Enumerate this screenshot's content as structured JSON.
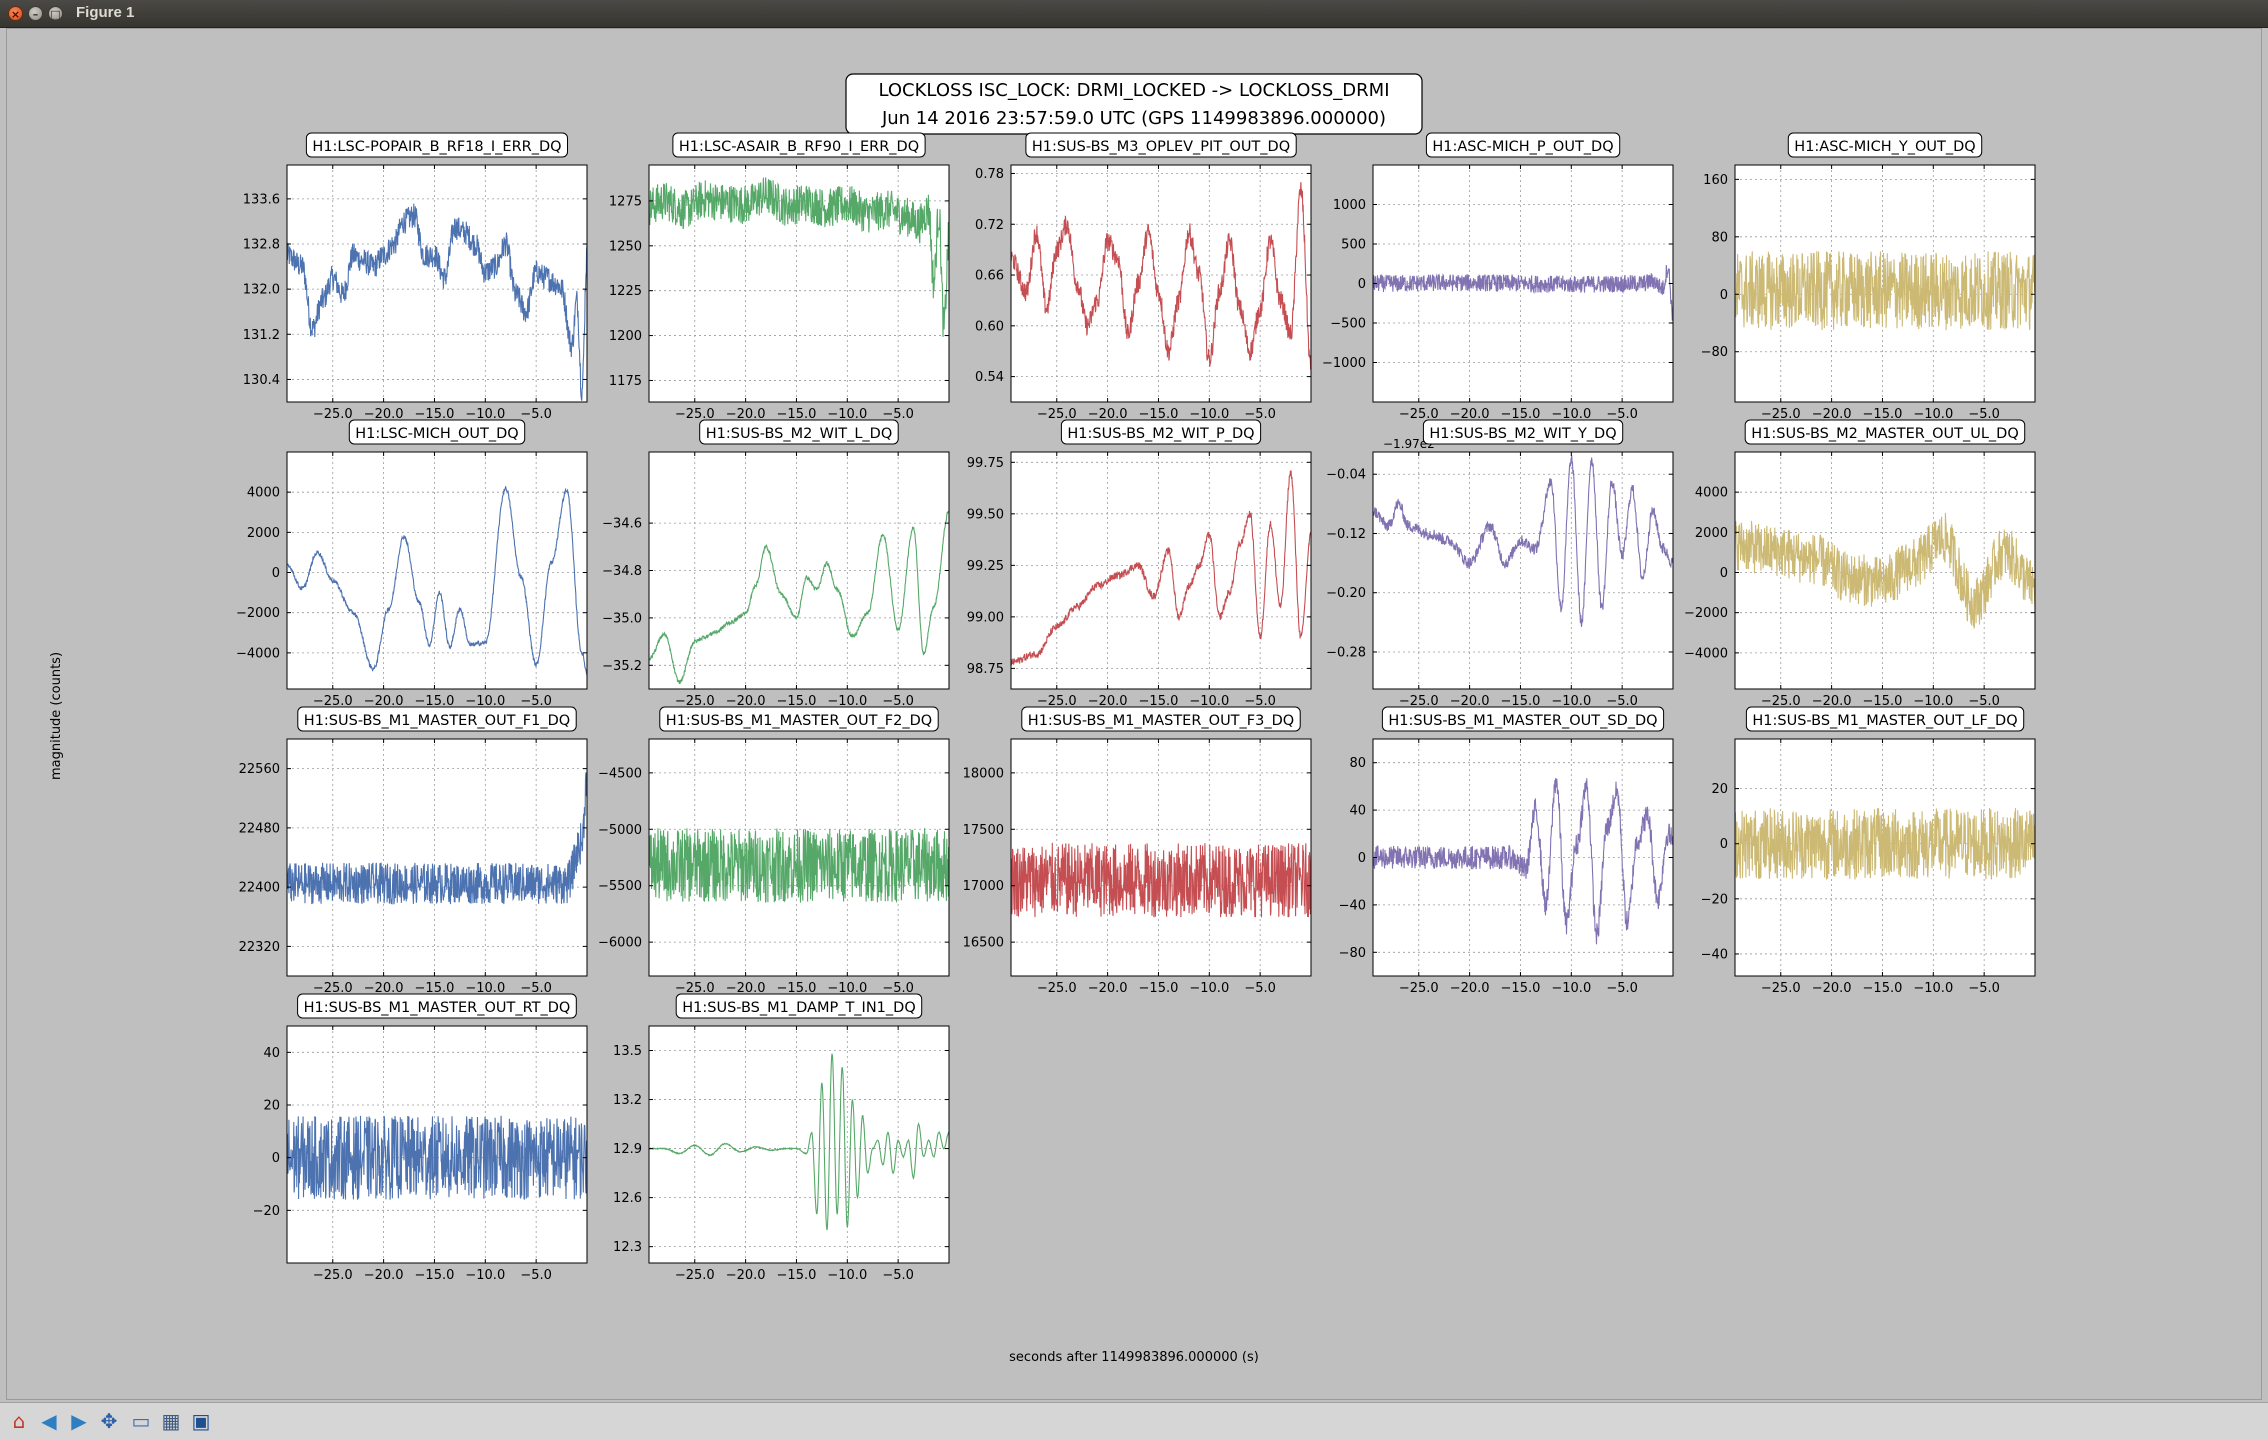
{
  "window": {
    "title": "Figure 1",
    "close_glyph": "×",
    "min_glyph": "–",
    "max_glyph": "□"
  },
  "figure": {
    "title_line1": "LOCKLOSS ISC_LOCK: DRMI_LOCKED -> LOCKLOSS_DRMI",
    "title_line2": "Jun 14 2016 23:57:59.0 UTC (GPS 1149983896.000000)",
    "ylabel": "magnitude (counts)",
    "xlabel": "seconds after 1149983896.000000 (s)"
  },
  "toolbar": [
    {
      "name": "home-icon",
      "glyph": "⌂",
      "color": "#c0392b"
    },
    {
      "name": "back-arrow-icon",
      "glyph": "◀",
      "color": "#2e7fc1"
    },
    {
      "name": "forward-arrow-icon",
      "glyph": "▶",
      "color": "#2e7fc1"
    },
    {
      "name": "pan-icon",
      "glyph": "✥",
      "color": "#2b5fa8"
    },
    {
      "name": "zoom-icon",
      "glyph": "▭",
      "color": "#3b6fb3"
    },
    {
      "name": "subplots-configure-icon",
      "glyph": "▦",
      "color": "#3d5a80"
    },
    {
      "name": "save-icon",
      "glyph": "▣",
      "color": "#1d4f91"
    }
  ],
  "chart_data": [
    {
      "type": "line",
      "title": "H1:LSC-POPAIR_B_RF18_I_ERR_DQ",
      "color": "#4c72b0",
      "xlim": [
        -29.5,
        0
      ],
      "xticks": [
        -25.0,
        -20.0,
        -15.0,
        -10.0,
        -5.0
      ],
      "ylim": [
        130.0,
        134.2
      ],
      "yticks": [
        130.4,
        131.2,
        132.0,
        132.8,
        133.6
      ],
      "ytick_labels": [
        "130.4",
        "131.2",
        "132.0",
        "132.8",
        "133.6"
      ],
      "grid": true,
      "noise": 0.22,
      "x": [
        -29.5,
        -28,
        -27,
        -26,
        -25,
        -24,
        -23,
        -22,
        -21,
        -20,
        -19,
        -18,
        -17,
        -16,
        -15,
        -14,
        -13,
        -12,
        -11,
        -10,
        -9,
        -8,
        -7,
        -6,
        -5,
        -4,
        -3,
        -2.5,
        -1.5,
        -1,
        -0.5,
        0
      ],
      "y": [
        132.6,
        132.4,
        131.3,
        131.8,
        132.2,
        131.9,
        132.6,
        132.5,
        132.4,
        132.6,
        132.8,
        133.2,
        133.3,
        132.6,
        132.6,
        132.2,
        133.1,
        133.0,
        132.8,
        132.3,
        132.4,
        132.8,
        131.9,
        131.6,
        132.3,
        132.2,
        132.1,
        132.0,
        131.0,
        131.8,
        130.2,
        132.6
      ]
    },
    {
      "type": "line",
      "title": "H1:LSC-ASAIR_B_RF90_I_ERR_DQ",
      "color": "#55a868",
      "xlim": [
        -29.5,
        0
      ],
      "xticks": [
        -25.0,
        -20.0,
        -15.0,
        -10.0,
        -5.0
      ],
      "ylim": [
        1163,
        1295
      ],
      "yticks": [
        1175,
        1200,
        1225,
        1250,
        1275
      ],
      "ytick_labels": [
        "1175",
        "1200",
        "1225",
        "1250",
        "1275"
      ],
      "grid": true,
      "noise": 11,
      "x": [
        -29.5,
        -28,
        -26,
        -24,
        -22,
        -20,
        -18,
        -16,
        -14,
        -12,
        -10,
        -8,
        -6,
        -4,
        -3,
        -2,
        -1.5,
        -1,
        -0.5,
        0
      ],
      "y": [
        1272,
        1275,
        1270,
        1276,
        1274,
        1273,
        1278,
        1272,
        1274,
        1271,
        1273,
        1268,
        1270,
        1266,
        1262,
        1270,
        1230,
        1268,
        1205,
        1255
      ]
    },
    {
      "type": "line",
      "title": "H1:SUS-BS_M3_OPLEV_PIT_OUT_DQ",
      "color": "#c44e52",
      "xlim": [
        -29.5,
        0
      ],
      "xticks": [
        -25.0,
        -20.0,
        -15.0,
        -10.0,
        -5.0
      ],
      "ylim": [
        0.51,
        0.79
      ],
      "yticks": [
        0.54,
        0.6,
        0.66,
        0.72,
        0.78
      ],
      "ytick_labels": [
        "0.54",
        "0.60",
        "0.66",
        "0.72",
        "0.78"
      ],
      "grid": true,
      "noise": 0.012,
      "x": [
        -29.5,
        -28,
        -27,
        -26,
        -25,
        -24,
        -23,
        -22,
        -21,
        -20,
        -19,
        -18,
        -17,
        -16,
        -15,
        -14,
        -13,
        -12,
        -11,
        -10,
        -9,
        -8,
        -7,
        -6,
        -5,
        -4,
        -3,
        -2,
        -1,
        0
      ],
      "y": [
        0.68,
        0.64,
        0.71,
        0.62,
        0.69,
        0.72,
        0.65,
        0.6,
        0.63,
        0.7,
        0.68,
        0.59,
        0.65,
        0.71,
        0.64,
        0.57,
        0.63,
        0.71,
        0.66,
        0.56,
        0.64,
        0.7,
        0.62,
        0.57,
        0.62,
        0.7,
        0.63,
        0.59,
        0.76,
        0.55
      ]
    },
    {
      "type": "line",
      "title": "H1:ASC-MICH_P_OUT_DQ",
      "color": "#8172b2",
      "xlim": [
        -29.5,
        0
      ],
      "xticks": [
        -25.0,
        -20.0,
        -15.0,
        -10.0,
        -5.0
      ],
      "ylim": [
        -1500,
        1500
      ],
      "yticks": [
        -1000,
        -500,
        0,
        500,
        1000
      ],
      "ytick_labels": [
        "−1000",
        "−500",
        "0",
        "500",
        "1000"
      ],
      "grid": true,
      "noise": 110,
      "x": [
        -29.5,
        -20,
        -10,
        -3,
        -2,
        -1,
        -0.5,
        0
      ],
      "y": [
        0,
        10,
        -10,
        0,
        30,
        -60,
        200,
        -400
      ]
    },
    {
      "type": "line",
      "title": "H1:ASC-MICH_Y_OUT_DQ",
      "color": "#ccb974",
      "xlim": [
        -29.5,
        0
      ],
      "xticks": [
        -25.0,
        -20.0,
        -15.0,
        -10.0,
        -5.0
      ],
      "ylim": [
        -150,
        180
      ],
      "yticks": [
        -80,
        0,
        80,
        160
      ],
      "ytick_labels": [
        "−80",
        "0",
        "80",
        "160"
      ],
      "grid": true,
      "noise": 55,
      "x": [
        -29.5,
        0
      ],
      "y": [
        5,
        5
      ]
    },
    {
      "type": "line",
      "title": "H1:LSC-MICH_OUT_DQ",
      "color": "#4c72b0",
      "xlim": [
        -29.5,
        0
      ],
      "xticks": [
        -25.0,
        -20.0,
        -15.0,
        -10.0,
        -5.0
      ],
      "ylim": [
        -5800,
        6000
      ],
      "yticks": [
        -4000,
        -2000,
        0,
        2000,
        4000
      ],
      "ytick_labels": [
        "−4000",
        "−2000",
        "0",
        "2000",
        "4000"
      ],
      "grid": true,
      "noise": 110,
      "x": [
        -29.5,
        -28,
        -26.5,
        -25,
        -23,
        -21,
        -19.5,
        -18,
        -16.5,
        -15.5,
        -14.5,
        -13.5,
        -12.5,
        -11.5,
        -10,
        -8,
        -6.5,
        -5,
        -3.5,
        -2,
        -0.5,
        0
      ],
      "y": [
        400,
        -800,
        1000,
        -400,
        -2000,
        -4800,
        -1800,
        1800,
        -1500,
        -3600,
        -1000,
        -3700,
        -1800,
        -3600,
        -3500,
        4200,
        -200,
        -4600,
        500,
        4100,
        -4000,
        -5000
      ]
    },
    {
      "type": "line",
      "title": "H1:SUS-BS_M2_WIT_L_DQ",
      "color": "#55a868",
      "xlim": [
        -29.5,
        0
      ],
      "xticks": [
        -25.0,
        -20.0,
        -15.0,
        -10.0,
        -5.0
      ],
      "ylim": [
        -35.3,
        -34.3
      ],
      "yticks": [
        -35.2,
        -35.0,
        -34.8,
        -34.6
      ],
      "ytick_labels": [
        "−35.2",
        "−35.0",
        "−34.8",
        "−34.6"
      ],
      "grid": true,
      "noise": 0.008,
      "x": [
        -29.5,
        -28,
        -26.5,
        -25,
        -24,
        -23,
        -21.5,
        -20,
        -19,
        -18,
        -16.5,
        -15,
        -14,
        -13,
        -12,
        -11,
        -9.5,
        -8,
        -6.5,
        -5,
        -3.5,
        -2.5,
        -1.5,
        0
      ],
      "y": [
        -35.17,
        -35.07,
        -35.27,
        -35.1,
        -35.08,
        -35.06,
        -35.02,
        -34.98,
        -34.86,
        -34.7,
        -34.9,
        -35.0,
        -34.83,
        -34.88,
        -34.77,
        -34.88,
        -35.08,
        -34.98,
        -34.65,
        -35.05,
        -34.62,
        -35.15,
        -34.95,
        -34.55
      ]
    },
    {
      "type": "line",
      "title": "H1:SUS-BS_M2_WIT_P_DQ",
      "color": "#c44e52",
      "xlim": [
        -29.5,
        0
      ],
      "xticks": [
        -25.0,
        -20.0,
        -15.0,
        -10.0,
        -5.0
      ],
      "ylim": [
        98.65,
        99.8
      ],
      "yticks": [
        98.75,
        99.0,
        99.25,
        99.5,
        99.75
      ],
      "ytick_labels": [
        "98.75",
        "99.00",
        "99.25",
        "99.50",
        "99.75"
      ],
      "grid": true,
      "noise": 0.018,
      "x": [
        -29.5,
        -27,
        -25,
        -23,
        -21,
        -19,
        -17,
        -15.5,
        -14,
        -13,
        -12,
        -11,
        -10,
        -9,
        -8,
        -7,
        -6,
        -5,
        -4,
        -3,
        -2,
        -1,
        0
      ],
      "y": [
        98.78,
        98.82,
        98.95,
        99.05,
        99.15,
        99.2,
        99.25,
        99.1,
        99.32,
        99.0,
        99.15,
        99.25,
        99.4,
        99.0,
        99.12,
        99.35,
        99.5,
        98.9,
        99.45,
        99.05,
        99.7,
        98.9,
        99.4
      ]
    },
    {
      "type": "line",
      "title": "H1:SUS-BS_M2_WIT_Y_DQ",
      "color": "#8172b2",
      "xlim": [
        -29.5,
        0
      ],
      "xticks": [
        -25.0,
        -20.0,
        -15.0,
        -10.0,
        -5.0
      ],
      "ylim": [
        -0.33,
        -0.01
      ],
      "yticks": [
        -0.28,
        -0.2,
        -0.12,
        -0.04
      ],
      "ytick_labels": [
        "−0.28",
        "−0.20",
        "−0.12",
        "−0.04"
      ],
      "offset_text": "−1.97e2",
      "grid": true,
      "noise": 0.008,
      "x": [
        -29.5,
        -28,
        -27,
        -26,
        -24,
        -22,
        -20,
        -18,
        -16.5,
        -15,
        -13.5,
        -12,
        -11,
        -10,
        -9,
        -8,
        -7,
        -6,
        -5,
        -4,
        -3,
        -2,
        -1,
        0
      ],
      "y": [
        -0.09,
        -0.11,
        -0.08,
        -0.11,
        -0.12,
        -0.13,
        -0.16,
        -0.11,
        -0.16,
        -0.13,
        -0.14,
        -0.05,
        -0.22,
        -0.02,
        -0.24,
        -0.02,
        -0.22,
        -0.05,
        -0.15,
        -0.06,
        -0.18,
        -0.09,
        -0.14,
        -0.16
      ]
    },
    {
      "type": "line",
      "title": "H1:SUS-BS_M2_MASTER_OUT_UL_DQ",
      "color": "#ccb974",
      "xlim": [
        -29.5,
        0
      ],
      "xticks": [
        -25.0,
        -20.0,
        -15.0,
        -10.0,
        -5.0
      ],
      "ylim": [
        -5800,
        6000
      ],
      "yticks": [
        -4000,
        -2000,
        0,
        2000,
        4000
      ],
      "ytick_labels": [
        "−4000",
        "−2000",
        "0",
        "2000",
        "4000"
      ],
      "grid": true,
      "noise": 1300,
      "x": [
        -29.5,
        -26,
        -22,
        -18,
        -15,
        -12,
        -9,
        -6,
        -3,
        0
      ],
      "y": [
        1400,
        1100,
        700,
        -300,
        -500,
        400,
        1700,
        -1500,
        1000,
        -700
      ]
    },
    {
      "type": "line",
      "title": "H1:SUS-BS_M1_MASTER_OUT_F1_DQ",
      "color": "#4c72b0",
      "xlim": [
        -29.5,
        0
      ],
      "xticks": [
        -25.0,
        -20.0,
        -15.0,
        -10.0,
        -5.0
      ],
      "ylim": [
        22280,
        22600
      ],
      "yticks": [
        22320,
        22400,
        22480,
        22560
      ],
      "ytick_labels": [
        "22320",
        "22400",
        "22480",
        "22560"
      ],
      "grid": true,
      "noise": 28,
      "x": [
        -29.5,
        -2,
        -0.5,
        0
      ],
      "y": [
        22405,
        22405,
        22460,
        22550
      ]
    },
    {
      "type": "line",
      "title": "H1:SUS-BS_M1_MASTER_OUT_F2_DQ",
      "color": "#55a868",
      "xlim": [
        -29.5,
        0
      ],
      "xticks": [
        -25.0,
        -20.0,
        -15.0,
        -10.0,
        -5.0
      ],
      "ylim": [
        -6300,
        -4200
      ],
      "yticks": [
        -6000,
        -5500,
        -5000,
        -4500
      ],
      "ytick_labels": [
        "−6000",
        "−5500",
        "−5000",
        "−4500"
      ],
      "grid": true,
      "noise": 330,
      "x": [
        -29.5,
        0
      ],
      "y": [
        -5320,
        -5320
      ]
    },
    {
      "type": "line",
      "title": "H1:SUS-BS_M1_MASTER_OUT_F3_DQ",
      "color": "#c44e52",
      "xlim": [
        -29.5,
        0
      ],
      "xticks": [
        -25.0,
        -20.0,
        -15.0,
        -10.0,
        -5.0
      ],
      "ylim": [
        16200,
        18300
      ],
      "yticks": [
        16500,
        17000,
        17500,
        18000
      ],
      "ytick_labels": [
        "16500",
        "17000",
        "17500",
        "18000"
      ],
      "grid": true,
      "noise": 330,
      "x": [
        -29.5,
        0
      ],
      "y": [
        17050,
        17050
      ]
    },
    {
      "type": "line",
      "title": "H1:SUS-BS_M1_MASTER_OUT_SD_DQ",
      "color": "#8172b2",
      "xlim": [
        -29.5,
        0
      ],
      "xticks": [
        -25.0,
        -20.0,
        -15.0,
        -10.0,
        -5.0
      ],
      "ylim": [
        -100,
        100
      ],
      "yticks": [
        -80,
        -40,
        0,
        40,
        80
      ],
      "ytick_labels": [
        "−80",
        "−40",
        "0",
        "40",
        "80"
      ],
      "grid": true,
      "noise": 10,
      "x": [
        -29.5,
        -16,
        -14.5,
        -13.5,
        -12.5,
        -11.5,
        -10.5,
        -9.5,
        -8.5,
        -7.5,
        -6.5,
        -5.5,
        -4.5,
        -3.5,
        -2.5,
        -1.5,
        -0.5,
        0
      ],
      "y": [
        0,
        0,
        -10,
        40,
        -40,
        65,
        -55,
        10,
        60,
        -65,
        25,
        55,
        -55,
        15,
        35,
        -35,
        20,
        15
      ]
    },
    {
      "type": "line",
      "title": "H1:SUS-BS_M1_MASTER_OUT_LF_DQ",
      "color": "#ccb974",
      "xlim": [
        -29.5,
        0
      ],
      "xticks": [
        -25.0,
        -20.0,
        -15.0,
        -10.0,
        -5.0
      ],
      "ylim": [
        -48,
        38
      ],
      "yticks": [
        -40,
        -20,
        0,
        20
      ],
      "ytick_labels": [
        "−40",
        "−20",
        "0",
        "20"
      ],
      "grid": true,
      "noise": 13,
      "x": [
        -29.5,
        0
      ],
      "y": [
        0,
        0
      ]
    },
    {
      "type": "line",
      "title": "H1:SUS-BS_M1_MASTER_OUT_RT_DQ",
      "color": "#4c72b0",
      "xlim": [
        -29.5,
        0
      ],
      "xticks": [
        -25.0,
        -20.0,
        -15.0,
        -10.0,
        -5.0
      ],
      "ylim": [
        -40,
        50
      ],
      "yticks": [
        -20,
        0,
        20,
        40
      ],
      "ytick_labels": [
        "−20",
        "0",
        "20",
        "40"
      ],
      "grid": true,
      "noise": 16,
      "x": [
        -29.5,
        0
      ],
      "y": [
        0,
        0
      ]
    },
    {
      "type": "line",
      "title": "H1:SUS-BS_M1_DAMP_T_IN1_DQ",
      "color": "#55a868",
      "xlim": [
        -29.5,
        0
      ],
      "xticks": [
        -25.0,
        -20.0,
        -15.0,
        -10.0,
        -5.0
      ],
      "ylim": [
        12.2,
        13.65
      ],
      "yticks": [
        12.3,
        12.6,
        12.9,
        13.2,
        13.5
      ],
      "ytick_labels": [
        "12.3",
        "12.6",
        "12.9",
        "13.2",
        "13.5"
      ],
      "grid": true,
      "noise": 0.003,
      "x": [
        -29.5,
        -28,
        -26.5,
        -25,
        -23.5,
        -22,
        -20.5,
        -19,
        -17.5,
        -16,
        -15,
        -14,
        -13.5,
        -13,
        -12.5,
        -12,
        -11.5,
        -11,
        -10.5,
        -10,
        -9.5,
        -9,
        -8.5,
        -8,
        -7.5,
        -7,
        -6.5,
        -6,
        -5.5,
        -5,
        -4.5,
        -4,
        -3.5,
        -3,
        -2.5,
        -2,
        -1.5,
        -1,
        -0.5,
        0
      ],
      "y": [
        12.9,
        12.9,
        12.87,
        12.92,
        12.86,
        12.93,
        12.88,
        12.91,
        12.89,
        12.9,
        12.9,
        12.87,
        13.0,
        12.5,
        13.3,
        12.4,
        13.48,
        12.5,
        13.4,
        12.42,
        13.2,
        12.6,
        13.1,
        12.75,
        12.9,
        12.95,
        12.8,
        13.0,
        12.75,
        12.95,
        12.85,
        12.95,
        12.72,
        13.05,
        12.85,
        12.95,
        12.85,
        13.0,
        12.9,
        13.0
      ]
    }
  ]
}
